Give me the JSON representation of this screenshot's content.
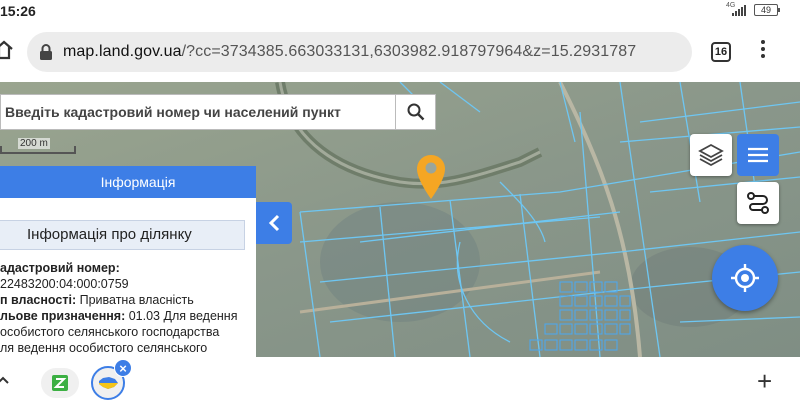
{
  "status": {
    "time": "15:26",
    "network": "4G",
    "battery": "49"
  },
  "browser": {
    "url_host": "map.land.gov.ua",
    "url_rest": "/?cc=3734385.663033131,6303982.918797964&z=15.2931787",
    "tab_count": "16"
  },
  "map": {
    "search_placeholder": "Введіть кадастровий номер чи населений пункт",
    "scale_label": "200 m"
  },
  "info_panel": {
    "header": "Інформація",
    "title": "Інформація про ділянку",
    "rows": [
      {
        "label": "адастровий номер:",
        "value": ""
      },
      {
        "label": "",
        "value": "22483200:04:000:0759"
      },
      {
        "label": "п власності:",
        "value": " Приватна власність"
      },
      {
        "label": "льове призначення:",
        "value": " 01.03 Для ведення"
      },
      {
        "label": "",
        "value": "особистого селянського господарства"
      },
      {
        "label": "",
        "value": "ля ведення особистого селянського"
      }
    ]
  },
  "colors": {
    "accent": "#3d7ee6",
    "marker": "#f5a623",
    "parcel_line": "#6ec6f2"
  }
}
